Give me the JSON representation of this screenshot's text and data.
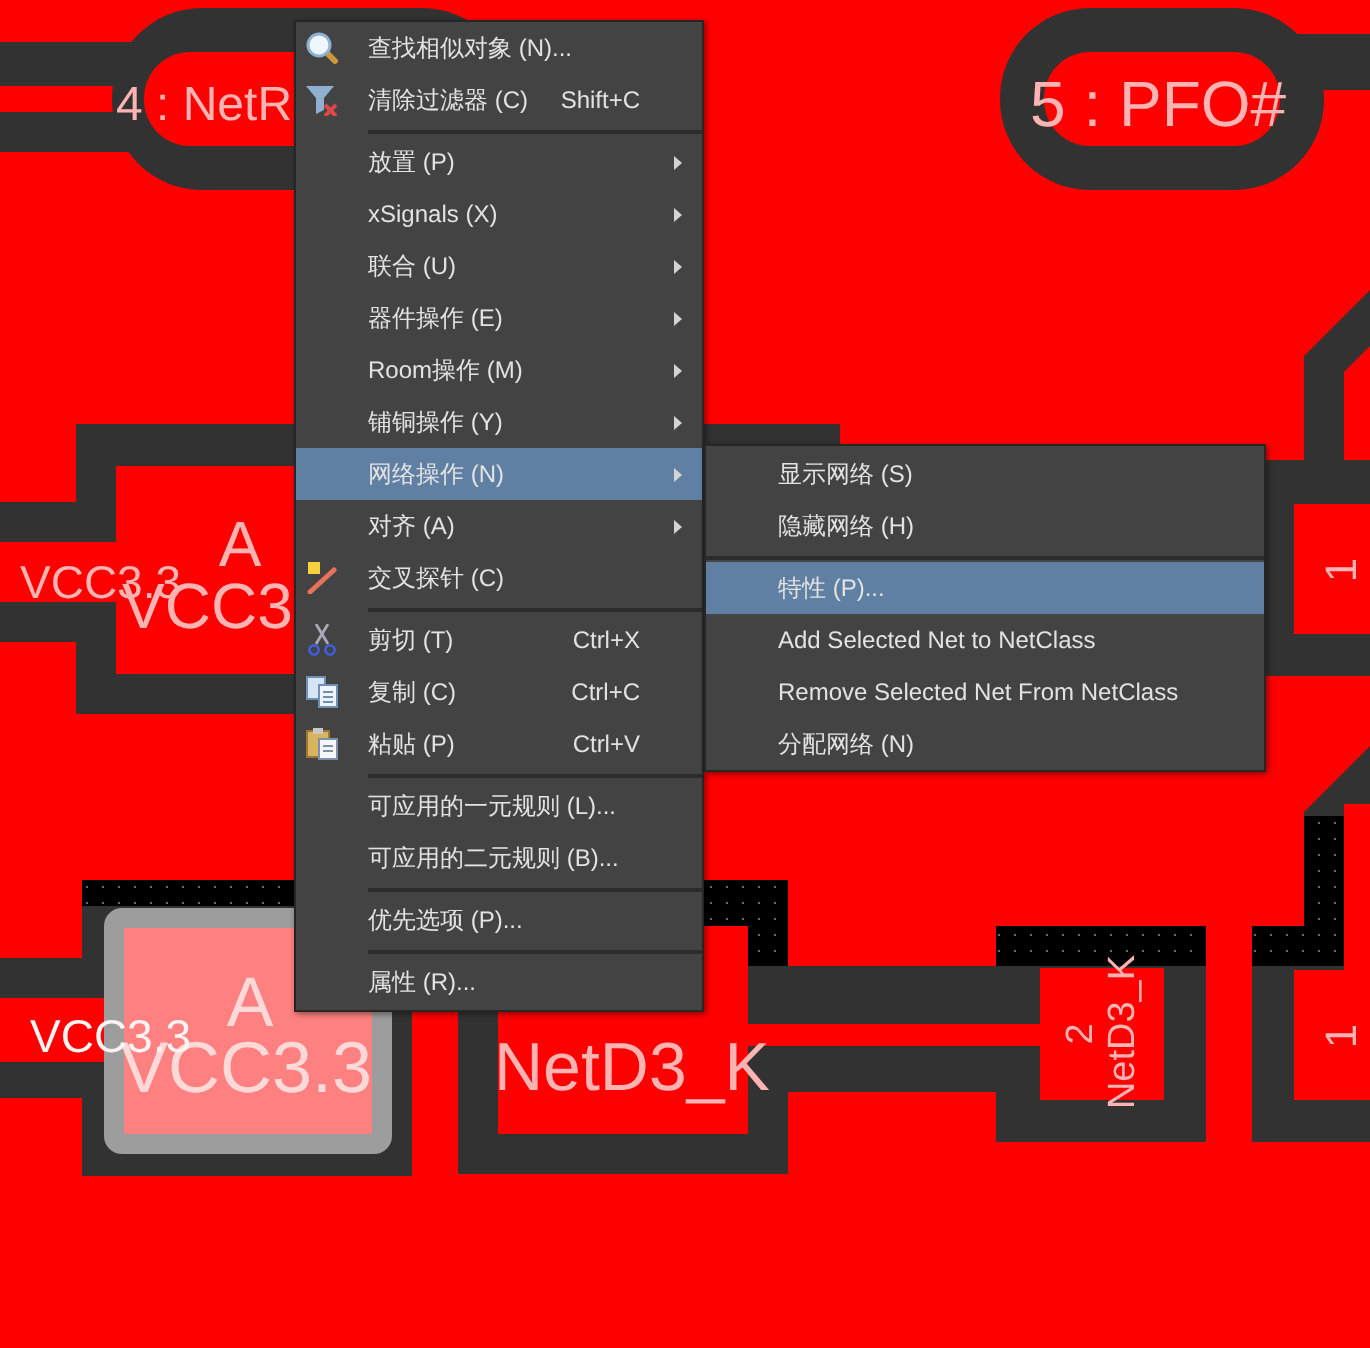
{
  "board": {
    "pads": [
      {
        "label": "4 : NetR",
        "selected": false
      },
      {
        "label": "5 : PFO#",
        "selected": false
      },
      {
        "designator": "A",
        "net": "VCC3",
        "selected": false
      },
      {
        "designator": "1",
        "selected": false
      },
      {
        "designator": "A",
        "net": "VCC3.3",
        "selected": true
      },
      {
        "net": "NetD3_K",
        "selected": false
      },
      {
        "designator": "2",
        "net": "NetD3_K",
        "selected": false
      },
      {
        "designator": "1",
        "selected": false
      }
    ],
    "traces": [
      {
        "net": "VCC3.3"
      },
      {
        "net": "VCC3.3"
      }
    ]
  },
  "context_menu": {
    "groups": [
      {
        "items": [
          {
            "kind": "command",
            "label": "查找相似对象 (N)...",
            "selected": false
          },
          {
            "kind": "command",
            "label": "清除过滤器 (C)",
            "shortcut": "Shift+C",
            "selected": false
          }
        ]
      },
      {
        "items": [
          {
            "kind": "submenu",
            "label": "放置 (P)",
            "selected": false
          },
          {
            "kind": "submenu",
            "label": "xSignals (X)",
            "selected": false
          },
          {
            "kind": "submenu",
            "label": "联合 (U)",
            "selected": false
          },
          {
            "kind": "submenu",
            "label": "器件操作 (E)",
            "selected": false
          },
          {
            "kind": "submenu",
            "label": "Room操作 (M)",
            "selected": false
          },
          {
            "kind": "submenu",
            "label": "铺铜操作 (Y)",
            "selected": false
          },
          {
            "kind": "submenu",
            "label": "网络操作 (N)",
            "selected": true
          },
          {
            "kind": "submenu",
            "label": "对齐 (A)",
            "selected": false
          },
          {
            "kind": "command",
            "label": "交叉探针 (C)",
            "selected": false
          }
        ]
      },
      {
        "items": [
          {
            "kind": "command",
            "label": "剪切 (T)",
            "shortcut": "Ctrl+X",
            "selected": false
          },
          {
            "kind": "command",
            "label": "复制 (C)",
            "shortcut": "Ctrl+C",
            "selected": false
          },
          {
            "kind": "command",
            "label": "粘贴 (P)",
            "shortcut": "Ctrl+V",
            "selected": false
          }
        ]
      },
      {
        "items": [
          {
            "kind": "command",
            "label": "可应用的一元规则 (L)...",
            "selected": false
          },
          {
            "kind": "command",
            "label": "可应用的二元规则 (B)...",
            "selected": false
          }
        ]
      },
      {
        "items": [
          {
            "kind": "command",
            "label": "优先选项 (P)...",
            "selected": false
          }
        ]
      },
      {
        "items": [
          {
            "kind": "command",
            "label": "属性 (R)...",
            "selected": false
          }
        ]
      }
    ]
  },
  "submenu": {
    "groups": [
      {
        "items": [
          {
            "kind": "command",
            "label": "显示网络 (S)",
            "selected": false
          },
          {
            "kind": "command",
            "label": "隐藏网络 (H)",
            "selected": false
          }
        ]
      },
      {
        "items": [
          {
            "kind": "command",
            "label": "特性 (P)...",
            "selected": true
          },
          {
            "kind": "command",
            "label": "Add Selected Net to NetClass",
            "selected": false
          },
          {
            "kind": "command",
            "label": "Remove Selected Net From NetClass",
            "selected": false
          },
          {
            "kind": "command",
            "label": "分配网络 (N)",
            "selected": false
          }
        ]
      }
    ]
  }
}
